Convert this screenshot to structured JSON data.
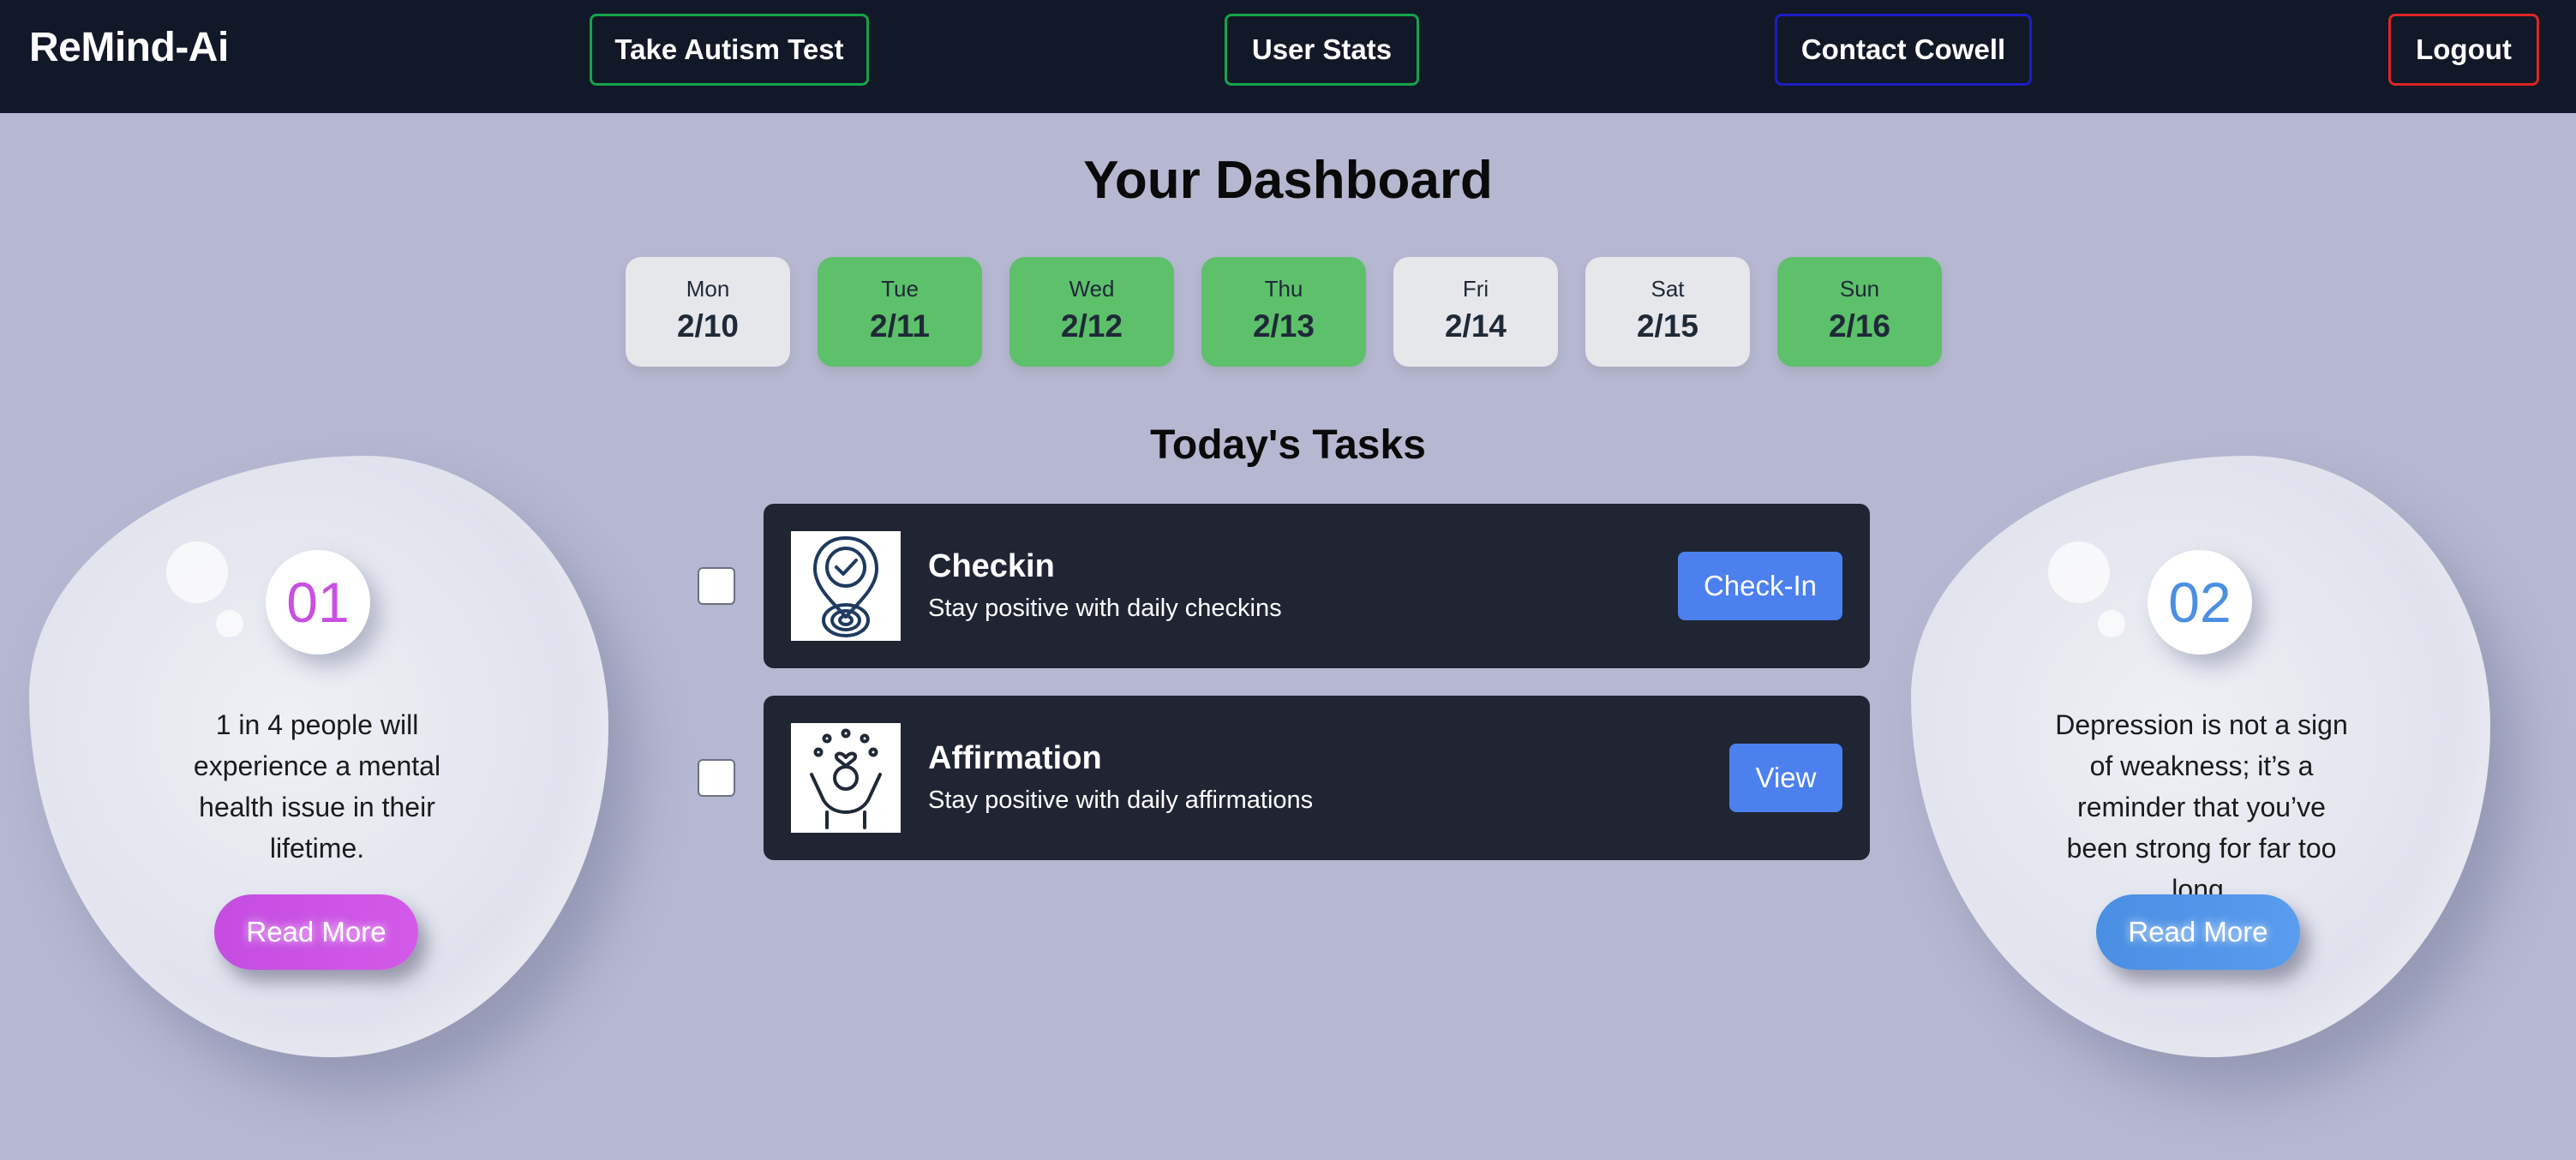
{
  "app": {
    "brand": "ReMind-Ai"
  },
  "nav": {
    "test_label": "Take Autism Test",
    "stats_label": "User Stats",
    "contact_label": "Contact Cowell",
    "logout_label": "Logout"
  },
  "dashboard": {
    "title": "Your Dashboard"
  },
  "week": [
    {
      "day": "Mon",
      "date": "2/10",
      "completed": false
    },
    {
      "day": "Tue",
      "date": "2/11",
      "completed": true
    },
    {
      "day": "Wed",
      "date": "2/12",
      "completed": true
    },
    {
      "day": "Thu",
      "date": "2/13",
      "completed": true
    },
    {
      "day": "Fri",
      "date": "2/14",
      "completed": false
    },
    {
      "day": "Sat",
      "date": "2/15",
      "completed": false
    },
    {
      "day": "Sun",
      "date": "2/16",
      "completed": true
    }
  ],
  "tasks": {
    "title": "Today's Tasks",
    "items": [
      {
        "name": "Checkin",
        "description": "Stay positive with daily checkins",
        "button": "Check-In",
        "icon": "location-check-icon",
        "checked": false
      },
      {
        "name": "Affirmation",
        "description": "Stay positive with daily affirmations",
        "button": "View",
        "icon": "self-love-icon",
        "checked": false
      }
    ]
  },
  "facts": [
    {
      "number": "01",
      "text": "1 in 4 people will experience a mental health issue in their lifetime.",
      "button": "Read More",
      "accent": "#c94fe0"
    },
    {
      "number": "02",
      "text": "Depression is not a sign of weakness; it’s a reminder that you’ve been strong for far too long.",
      "button": "Read More",
      "accent": "#4a8fe2"
    }
  ],
  "colors": {
    "background": "#b5b8d0",
    "navbar": "#111827",
    "task_card": "#1f2533",
    "day_completed": "#5dc06b",
    "day_default": "#e5e7eb",
    "primary_button": "#4c80ef"
  }
}
